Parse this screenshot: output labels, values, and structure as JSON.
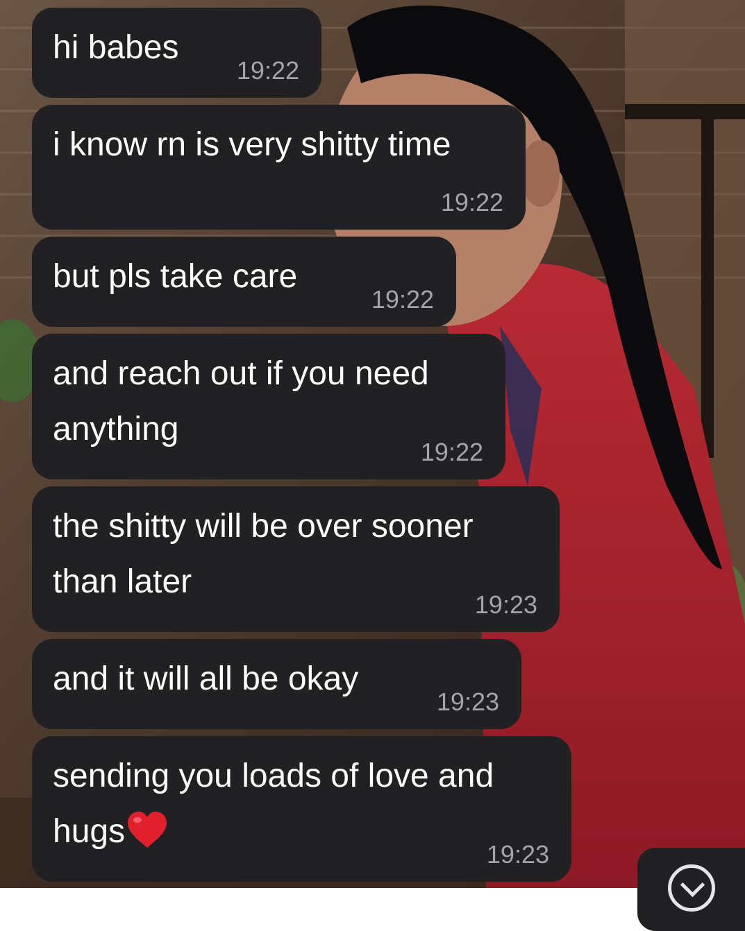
{
  "chat": {
    "messages": [
      {
        "text_lines": [
          "hi babes"
        ],
        "time": "19:22"
      },
      {
        "text_lines": [
          "i know rn is very shitty time"
        ],
        "time": "19:22"
      },
      {
        "text_lines": [
          "but pls take care"
        ],
        "time": "19:22"
      },
      {
        "text_lines": [
          "and reach out if you need",
          "anything"
        ],
        "time": "19:22"
      },
      {
        "text_lines": [
          "the shitty will be over sooner",
          "than later"
        ],
        "time": "19:23"
      },
      {
        "text_lines": [
          "and it will all be okay"
        ],
        "time": "19:23"
      },
      {
        "text_lines": [
          "sending you loads of love and",
          "hugs"
        ],
        "time": "19:23",
        "trailing_icon": "red-heart-icon"
      }
    ],
    "scroll_button_icon": "chevron-down-icon",
    "colors": {
      "bubble": "#212124",
      "text": "#ffffff",
      "time": "#a3a3a8",
      "heart": "#e0202c"
    }
  }
}
